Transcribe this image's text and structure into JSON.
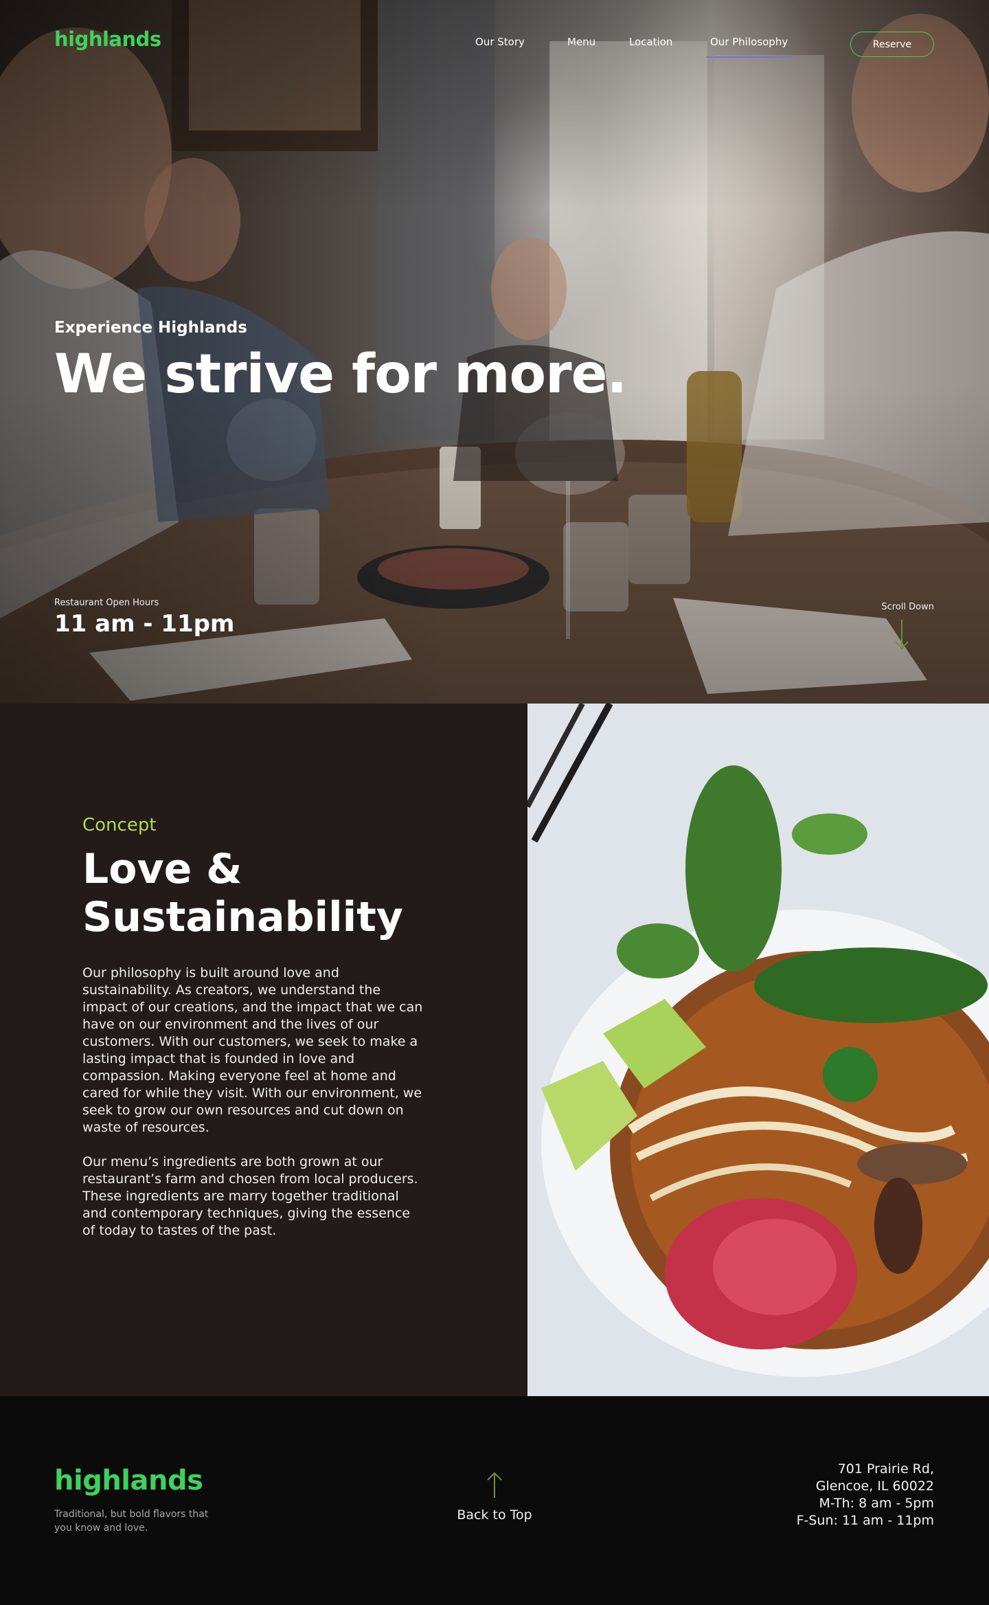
{
  "brand": {
    "name": "highlands",
    "accent_color": "#3fd15c"
  },
  "nav": {
    "items": [
      {
        "label": "Our Story"
      },
      {
        "label": "Menu"
      },
      {
        "label": "Location"
      },
      {
        "label": "Our Philosophy"
      }
    ],
    "active": "Our Philosophy",
    "reserve_label": "Reserve"
  },
  "hero": {
    "eyebrow": "Experience Highlands",
    "headline": "We strive for more.",
    "hours_label": "Restaurant Open Hours",
    "hours": "11 am - 11pm",
    "scroll_label": "Scroll Down",
    "scroll_icon": "arrow-down-icon"
  },
  "concept": {
    "kicker": "Concept",
    "title": "Love & Sustainability",
    "paragraphs": [
      "Our philosophy is built around love and sustainability. As creators, we understand the impact of our creations, and the impact that we can have on our environment and the lives of our customers. With our customers, we seek to make a lasting impact that is founded in love and compassion. Making everyone feel at home and cared for while they visit. With our environment, we seek to grow our own resources and cut down on waste of resources.",
      "Our menu’s ingredients are both grown at our restaurant’s farm and chosen from local producers. These ingredients are marry together traditional and contemporary techniques, giving the essence of today to tastes of the past."
    ],
    "kicker_color": "#b9d84a",
    "panel_color": "#221b1a"
  },
  "footer": {
    "tagline": "Traditional, but bold flavors that you know and love.",
    "back_to_top": "Back to Top",
    "back_icon": "arrow-up-icon",
    "address": [
      "701 Prairie Rd,",
      "Glencoe, IL 60022",
      "M-Th: 8 am - 5pm",
      "F-Sun: 11 am - 11pm"
    ]
  }
}
